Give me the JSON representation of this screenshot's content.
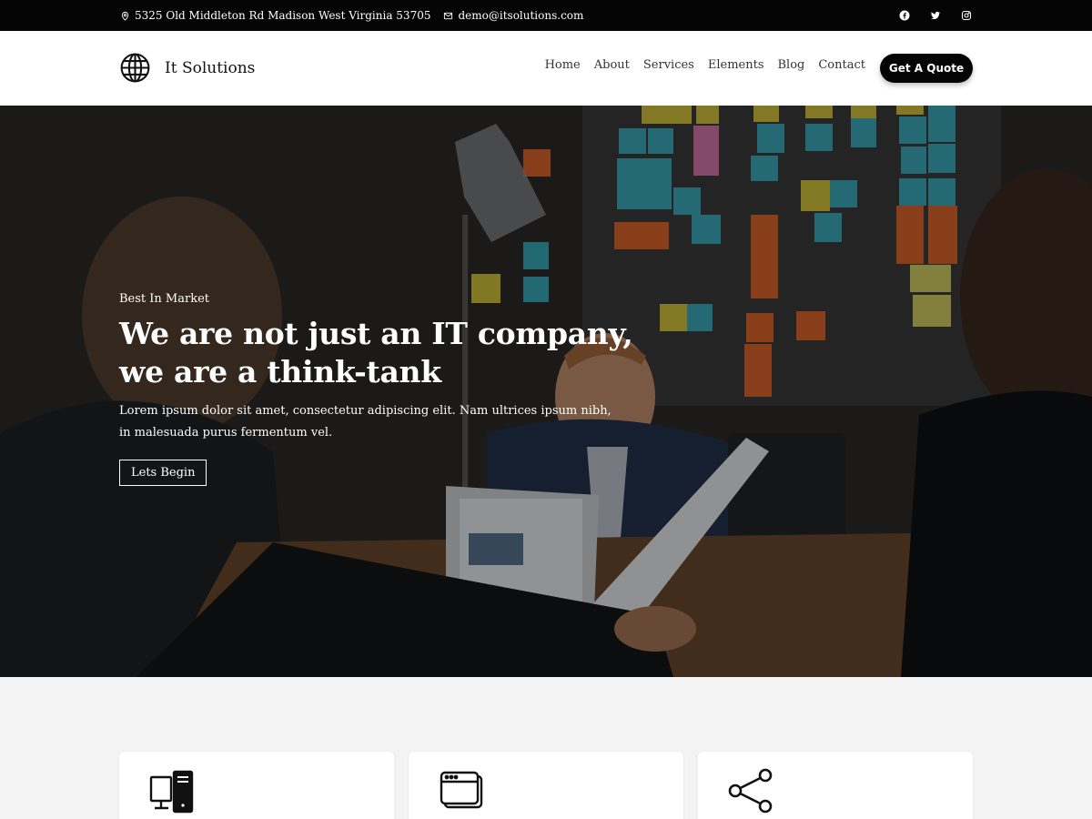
{
  "topbar": {
    "address": "5325 Old Middleton Rd Madison West Virginia 53705",
    "email": "demo@itsolutions.com",
    "social": [
      "facebook-icon",
      "twitter-icon",
      "instagram-icon"
    ]
  },
  "header": {
    "brand": "It Solutions",
    "nav": [
      "Home",
      "About",
      "Services",
      "Elements",
      "Blog",
      "Contact"
    ],
    "cta": "Get A Quote"
  },
  "hero": {
    "kicker": "Best In Market",
    "title_line1": "We are not just an IT company,",
    "title_line2": "we are a think-tank",
    "text_line1": "Lorem ipsum dolor sit amet, consectetur adipiscing elit. Nam ultrices ipsum nibh,",
    "text_line2": "in malesuada purus fermentum vel.",
    "button": "Lets Begin"
  },
  "services": {
    "cards": [
      {
        "icon": "desktop-computer-icon"
      },
      {
        "icon": "browser-window-icon"
      },
      {
        "icon": "share-icon"
      }
    ]
  },
  "colors": {
    "dark": "#050505",
    "accent": "#ffffff",
    "section_bg": "#f3f3f3"
  }
}
